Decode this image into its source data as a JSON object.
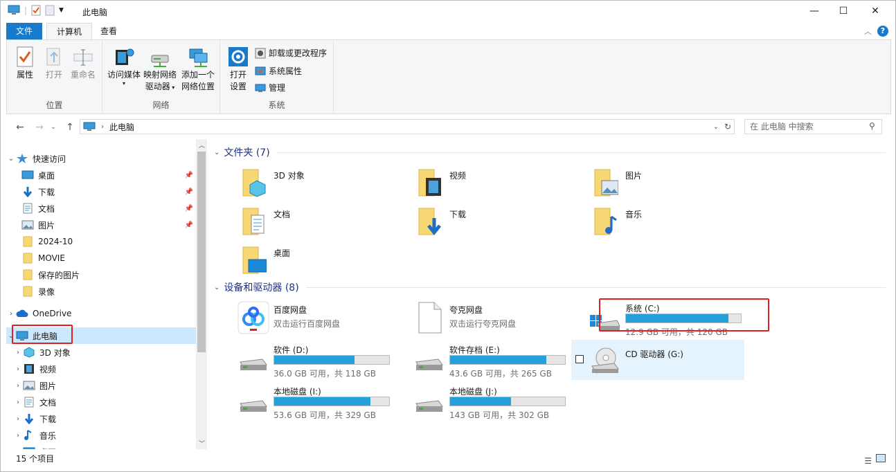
{
  "window": {
    "title": "此电脑",
    "controls": {
      "minimize": "—",
      "maximize": "☐",
      "close": "✕"
    }
  },
  "tabs": {
    "file": "文件",
    "computer": "计算机",
    "view": "查看"
  },
  "ribbon": {
    "location": {
      "label": "位置",
      "properties": "属性",
      "open": "打开",
      "rename": "重命名"
    },
    "network": {
      "label": "网络",
      "access_media": "访问媒体",
      "map_drive_line1": "映射网络",
      "map_drive_line2": "驱动器",
      "add_location_line1": "添加一个",
      "add_location_line2": "网络位置"
    },
    "system": {
      "label": "系统",
      "open_settings_line1": "打开",
      "open_settings_line2": "设置",
      "uninstall": "卸载或更改程序",
      "system_properties": "系统属性",
      "manage": "管理"
    }
  },
  "address": {
    "path": "此电脑",
    "search_placeholder": "在 此电脑 中搜索"
  },
  "nav": {
    "quick_access": "快速访问",
    "items_quick": [
      {
        "label": "桌面"
      },
      {
        "label": "下载"
      },
      {
        "label": "文档"
      },
      {
        "label": "图片"
      },
      {
        "label": "2024-10"
      },
      {
        "label": "MOVIE"
      },
      {
        "label": "保存的图片"
      },
      {
        "label": "录像"
      }
    ],
    "onedrive": "OneDrive",
    "this_pc": "此电脑",
    "items_pc": [
      {
        "label": "3D 对象"
      },
      {
        "label": "视频"
      },
      {
        "label": "图片"
      },
      {
        "label": "文档"
      },
      {
        "label": "下载"
      },
      {
        "label": "音乐"
      },
      {
        "label": "桌面"
      }
    ]
  },
  "content": {
    "folders_header": "文件夹 (7)",
    "folders": [
      {
        "name": "3D 对象"
      },
      {
        "name": "视频"
      },
      {
        "name": "图片"
      },
      {
        "name": "文档"
      },
      {
        "name": "下载"
      },
      {
        "name": "音乐"
      },
      {
        "name": "桌面"
      }
    ],
    "devices_header": "设备和驱动器 (8)",
    "apps": [
      {
        "name": "百度网盘",
        "sub": "双击运行百度网盘"
      },
      {
        "name": "夸克网盘",
        "sub": "双击运行夸克网盘"
      }
    ],
    "drives": [
      {
        "name": "系统 (C:)",
        "sub": "12.9 GB 可用，共 120 GB",
        "used_fraction": 0.89
      },
      {
        "name": "软件 (D:)",
        "sub": "36.0 GB 可用，共 118 GB",
        "used_fraction": 0.7
      },
      {
        "name": "软件存档 (E:)",
        "sub": "43.6 GB 可用，共 265 GB",
        "used_fraction": 0.84
      },
      {
        "name": "本地磁盘 (I:)",
        "sub": "53.6 GB 可用，共 329 GB",
        "used_fraction": 0.84
      },
      {
        "name": "本地磁盘 (J:)",
        "sub": "143 GB 可用，共 302 GB",
        "used_fraction": 0.53
      }
    ],
    "cd_drive": {
      "name": "CD 驱动器 (G:)"
    }
  },
  "status": {
    "count": "15 个项目"
  },
  "colors": {
    "accent": "#1979ca",
    "bar_fill": "#26a0da",
    "selection": "#cce8ff",
    "highlight_box": "#e02020"
  }
}
